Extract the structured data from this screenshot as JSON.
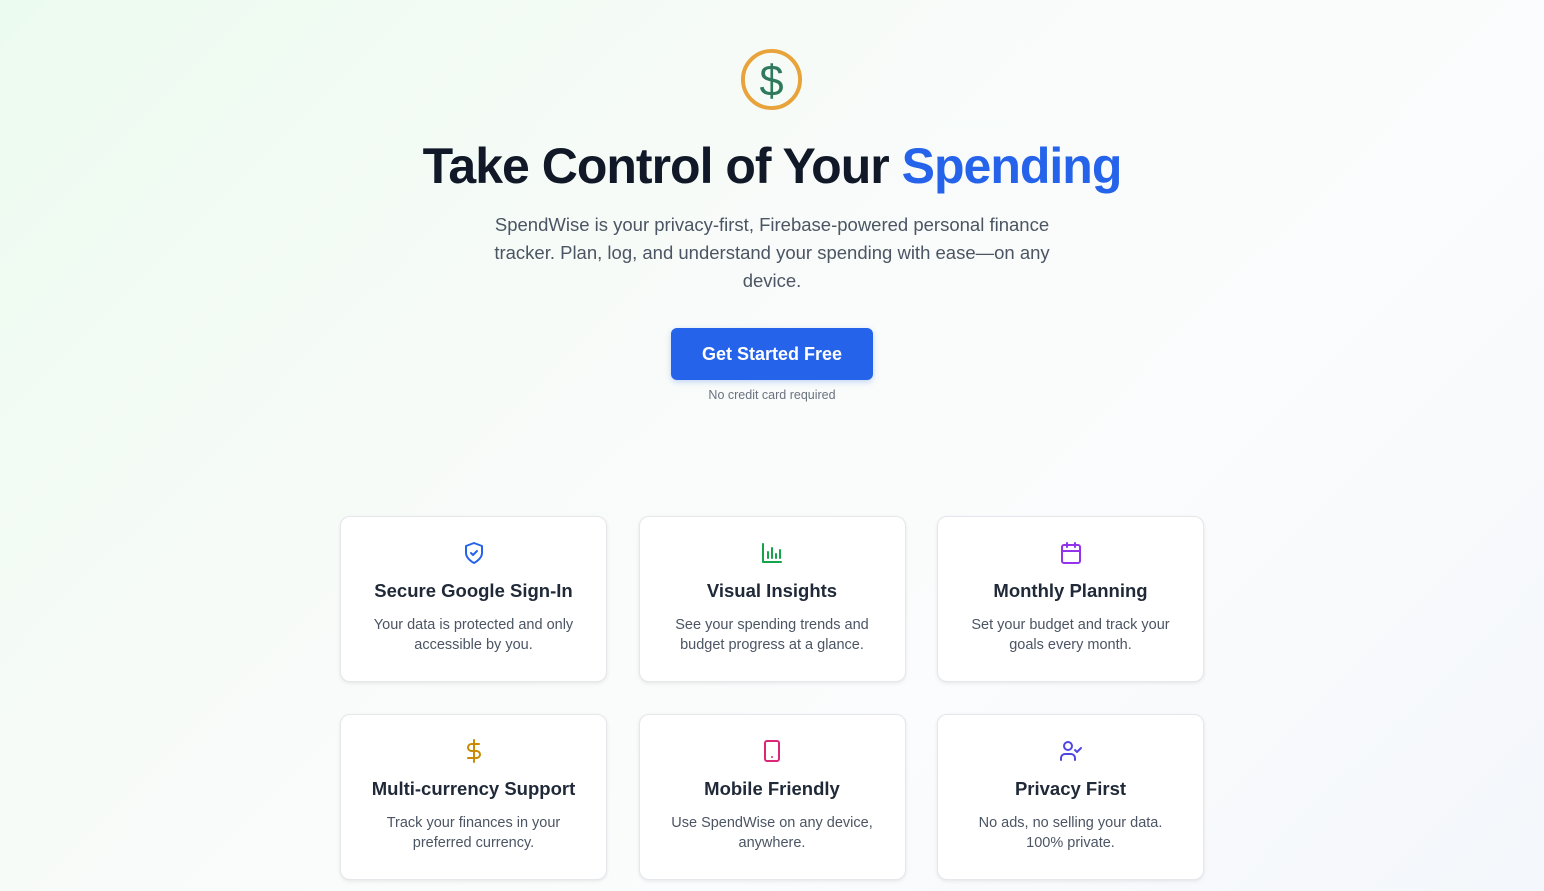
{
  "hero": {
    "title_main": "Take Control of Your ",
    "title_accent": "Spending",
    "subtitle": "SpendWise is your privacy-first, Firebase-powered personal finance tracker. Plan, log, and understand your spending with ease—on any device.",
    "cta_label": "Get Started Free",
    "cta_note": "No credit card required",
    "logo_icon": "dollar-circle-icon"
  },
  "colors": {
    "accent": "#2563eb",
    "logo_ring": "#e8a33a",
    "logo_symbol": "#2f7a5c"
  },
  "features": [
    {
      "title": "Secure Google Sign-In",
      "description": "Your data is protected and only accessible by you.",
      "icon": "shield-check-icon",
      "icon_color": "#2563eb"
    },
    {
      "title": "Visual Insights",
      "description": "See your spending trends and budget progress at a glance.",
      "icon": "bar-chart-icon",
      "icon_color": "#16a34a"
    },
    {
      "title": "Monthly Planning",
      "description": "Set your budget and track your goals every month.",
      "icon": "calendar-icon",
      "icon_color": "#9333ea"
    },
    {
      "title": "Multi-currency Support",
      "description": "Track your finances in your preferred currency.",
      "icon": "dollar-icon",
      "icon_color": "#ca8a04"
    },
    {
      "title": "Mobile Friendly",
      "description": "Use SpendWise on any device, anywhere.",
      "icon": "tablet-icon",
      "icon_color": "#db2777"
    },
    {
      "title": "Privacy First",
      "description": "No ads, no selling your data. 100% private.",
      "icon": "user-check-icon",
      "icon_color": "#4f46e5"
    }
  ]
}
